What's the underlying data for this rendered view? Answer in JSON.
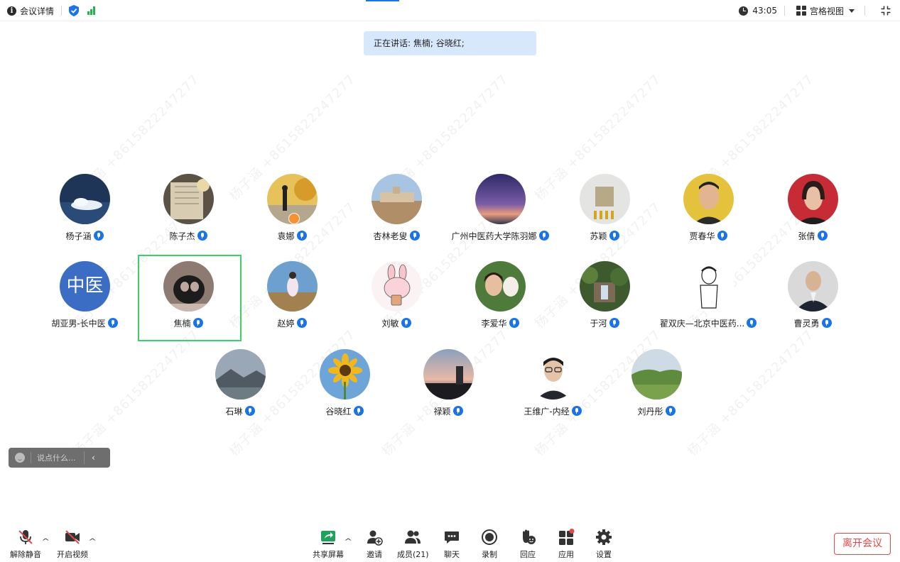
{
  "topbar": {
    "meeting_details": "会议详情",
    "timer": "43:05",
    "view_mode": "宫格视图"
  },
  "speaking": {
    "text": "正在讲话: 焦楠; 谷晓红;"
  },
  "watermark": "杨子涵 +8615822247277",
  "participants": [
    {
      "name": "杨子涵",
      "mic": "on"
    },
    {
      "name": "陈子杰",
      "mic": "on"
    },
    {
      "name": "袁娜",
      "mic": "on"
    },
    {
      "name": "杏林老叟",
      "mic": "on"
    },
    {
      "name": "广州中医药大学陈羽娜",
      "mic": "on"
    },
    {
      "name": "苏颖",
      "mic": "on"
    },
    {
      "name": "贾春华",
      "mic": "on"
    },
    {
      "name": "张倩",
      "mic": "on"
    },
    {
      "name": "胡亚男-长中医",
      "mic": "on",
      "avatar_text": "中医"
    },
    {
      "name": "焦楠",
      "mic": "speaking"
    },
    {
      "name": "赵婷",
      "mic": "on"
    },
    {
      "name": "刘敏",
      "mic": "on"
    },
    {
      "name": "李爱华",
      "mic": "on"
    },
    {
      "name": "于河",
      "mic": "on"
    },
    {
      "name": "翟双庆—北京中医药...",
      "mic": "on"
    },
    {
      "name": "曹灵勇",
      "mic": "on"
    },
    {
      "name": "石琳",
      "mic": "on"
    },
    {
      "name": "谷晓红",
      "mic": "speaking"
    },
    {
      "name": "禄颖",
      "mic": "on"
    },
    {
      "name": "王维广-内经",
      "mic": "on"
    },
    {
      "name": "刘丹彤",
      "mic": "on"
    }
  ],
  "chat": {
    "placeholder": "说点什么..."
  },
  "toolbar": {
    "unmute": "解除静音",
    "start_video": "开启视频",
    "share_screen": "共享屏幕",
    "invite": "邀请",
    "members": "成员(21)",
    "chat": "聊天",
    "record": "录制",
    "reactions": "回应",
    "apps": "应用",
    "settings": "设置",
    "leave": "离开会议"
  },
  "colors": {
    "accent": "#1a73e8",
    "speaking_border": "#3ccf6c",
    "leave": "#e34949",
    "banner": "#d7e8fc"
  }
}
